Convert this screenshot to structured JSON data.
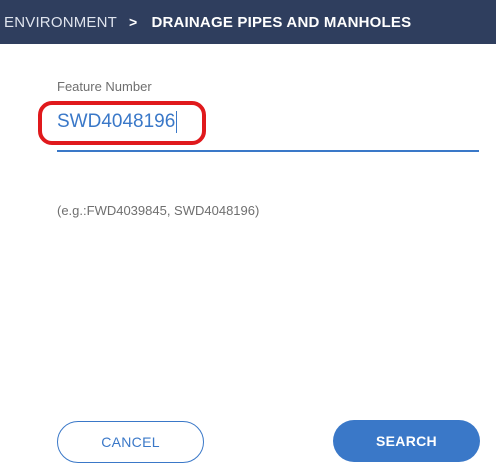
{
  "header": {
    "root": "ENVIRONMENT",
    "separator": ">",
    "current": "DRAINAGE PIPES AND MANHOLES"
  },
  "form": {
    "label": "Feature Number",
    "value": "SWD4048196",
    "hint": "(e.g.:FWD4039845, SWD4048196)"
  },
  "buttons": {
    "cancel": "CANCEL",
    "search": "SEARCH"
  },
  "colors": {
    "header_bg": "#2f3e5e",
    "accent": "#3a78c8",
    "highlight": "#e0191c"
  }
}
